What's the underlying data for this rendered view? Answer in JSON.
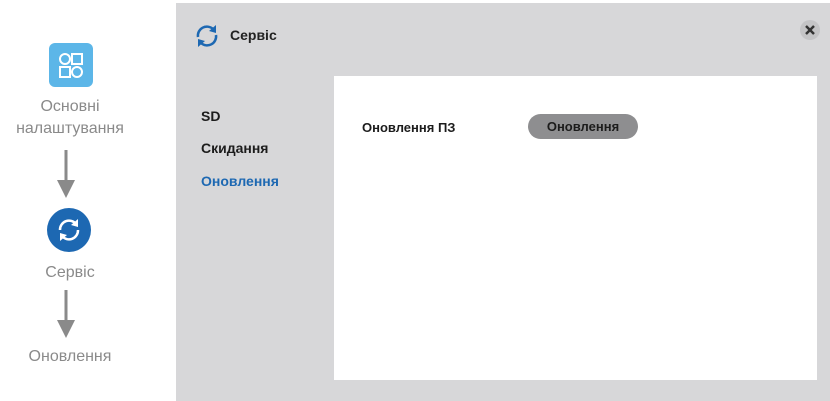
{
  "flow": {
    "steps": [
      {
        "label_line1": "Основні",
        "label_line2": "налаштування",
        "icon": "grid-settings-icon"
      },
      {
        "label": "Сервіс",
        "icon": "refresh-icon"
      },
      {
        "label": "Оновлення"
      }
    ]
  },
  "dialog": {
    "title": "Сервіс",
    "title_icon": "refresh-icon",
    "close_icon": "close-icon"
  },
  "nav": {
    "items": [
      {
        "label": "SD"
      },
      {
        "label": "Скидання"
      },
      {
        "label": "Оновлення",
        "active": true
      }
    ]
  },
  "content": {
    "row_label": "Оновлення ПЗ",
    "button_label": "Оновлення"
  },
  "colors": {
    "accent": "#1d68b2",
    "light_accent": "#5cb6e8",
    "panel_bg": "#d7d7d9",
    "button_bg": "#8e8e90"
  }
}
